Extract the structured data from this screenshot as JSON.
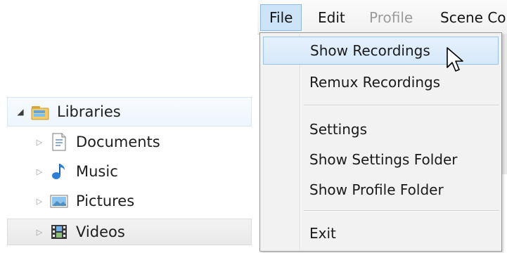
{
  "explorer": {
    "libraries_label": "Libraries",
    "children": [
      {
        "label": "Documents",
        "icon": "document-icon"
      },
      {
        "label": "Music",
        "icon": "music-icon"
      },
      {
        "label": "Pictures",
        "icon": "pictures-icon"
      },
      {
        "label": "Videos",
        "icon": "videos-icon"
      }
    ]
  },
  "app": {
    "menubar": {
      "file": "File",
      "edit": "Edit",
      "profile": "Profile",
      "scene": "Scene Co"
    },
    "file_menu": {
      "show_recordings": "Show Recordings",
      "remux_recordings": "Remux Recordings",
      "settings": "Settings",
      "show_settings_folder": "Show Settings Folder",
      "show_profile_folder": "Show Profile Folder",
      "exit": "Exit"
    }
  },
  "colors": {
    "menu_active_bg": "#cde3f7",
    "menu_hover_border": "#99c3ea",
    "library_folder": "#e7c05a",
    "music_note": "#2e7fd6"
  }
}
